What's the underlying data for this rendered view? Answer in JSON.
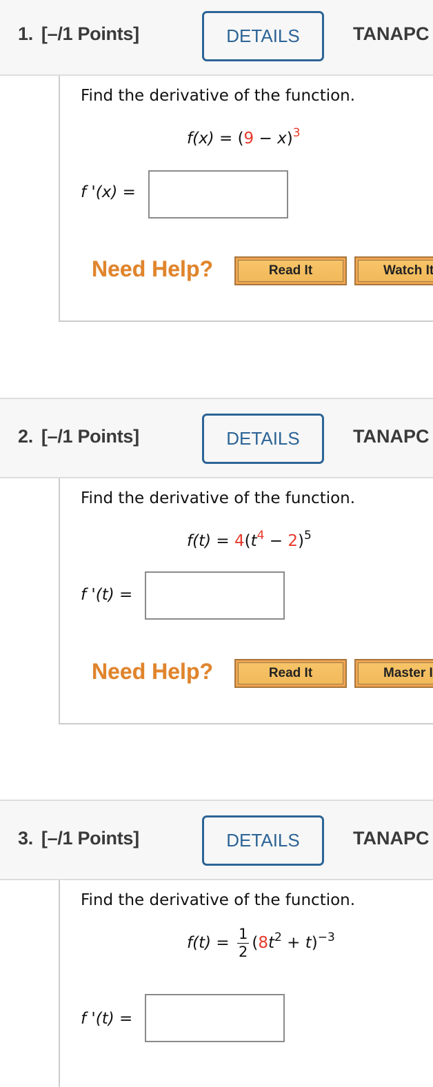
{
  "questions": [
    {
      "number": "1.",
      "points": "[–/1 Points]",
      "details_label": "DETAILS",
      "source_label": "TANAPC",
      "prompt": "Find the derivative of the function.",
      "formula": {
        "lhs": "f(x)",
        "eq": "=",
        "parts": [
          "(",
          "9",
          " − ",
          "x",
          ")",
          "3"
        ]
      },
      "answer_label": "f '(x) =",
      "answer_value": "",
      "help_label": "Need Help?",
      "help_buttons": [
        "Read It",
        "Watch It"
      ]
    },
    {
      "number": "2.",
      "points": "[–/1 Points]",
      "details_label": "DETAILS",
      "source_label": "TANAPC",
      "prompt": "Find the derivative of the function.",
      "formula": {
        "lhs": "f(t)",
        "eq": "=",
        "parts": [
          "4",
          "(",
          "t",
          "4",
          " − ",
          "2",
          ")",
          "5"
        ]
      },
      "answer_label": "f '(t) =",
      "answer_value": "",
      "help_label": "Need Help?",
      "help_buttons": [
        "Read It",
        "Master It"
      ]
    },
    {
      "number": "3.",
      "points": "[–/1 Points]",
      "details_label": "DETAILS",
      "source_label": "TANAPC",
      "prompt": "Find the derivative of the function.",
      "formula": {
        "lhs": "f(t)",
        "eq": "=",
        "frac_num": "1",
        "frac_den": "2",
        "parts": [
          "(",
          "8",
          "t",
          "2",
          " + ",
          "t",
          ")",
          "−3"
        ]
      },
      "answer_label": "f '(t) =",
      "answer_value": ""
    }
  ],
  "colors": {
    "accent_blue": "#2c6496",
    "highlight_red": "#e8382b",
    "help_orange": "#e0842c",
    "button_gold": "#f1b95a"
  }
}
